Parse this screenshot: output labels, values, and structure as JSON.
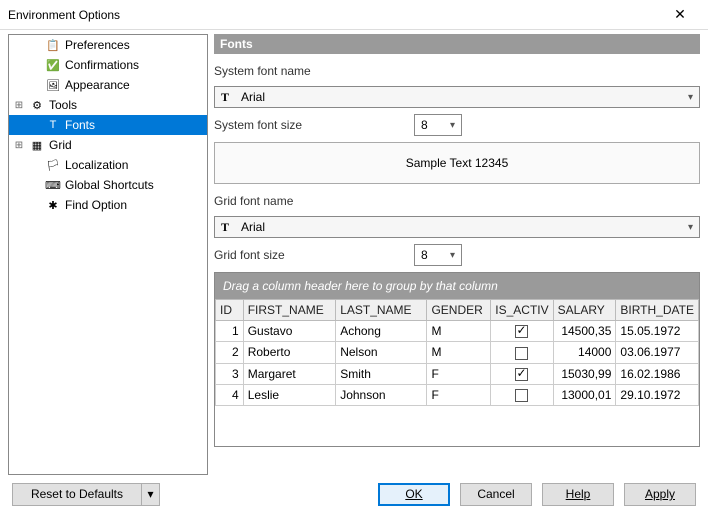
{
  "window": {
    "title": "Environment Options"
  },
  "tree": {
    "items": [
      {
        "label": "Preferences",
        "depth": 1
      },
      {
        "label": "Confirmations",
        "depth": 1
      },
      {
        "label": "Appearance",
        "depth": 1
      },
      {
        "label": "Tools",
        "depth": 0,
        "expander": "+"
      },
      {
        "label": "Fonts",
        "depth": 1,
        "selected": true
      },
      {
        "label": "Grid",
        "depth": 0,
        "expander": "+"
      },
      {
        "label": "Localization",
        "depth": 1
      },
      {
        "label": "Global Shortcuts",
        "depth": 1
      },
      {
        "label": "Find Option",
        "depth": 1
      }
    ]
  },
  "panel": {
    "title": "Fonts",
    "system_font_label": "System font name",
    "system_font_value": "Arial",
    "system_size_label": "System font size",
    "system_size_value": "8",
    "sample_text": "Sample Text 12345",
    "grid_font_label": "Grid font name",
    "grid_font_value": "Arial",
    "grid_size_label": "Grid font size",
    "grid_size_value": "8",
    "group_hint": "Drag a column header here to group by that column",
    "columns": [
      "ID",
      "FIRST_NAME",
      "LAST_NAME",
      "GENDER",
      "IS_ACTIV",
      "SALARY",
      "BIRTH_DATE"
    ],
    "rows": [
      {
        "id": "1",
        "fn": "Gustavo",
        "ln": "Achong",
        "g": "M",
        "active": true,
        "salary": "14500,35",
        "birth": "15.05.1972"
      },
      {
        "id": "2",
        "fn": "Roberto",
        "ln": "Nelson",
        "g": "M",
        "active": false,
        "salary": "14000",
        "birth": "03.06.1977"
      },
      {
        "id": "3",
        "fn": "Margaret",
        "ln": "Smith",
        "g": "F",
        "active": true,
        "salary": "15030,99",
        "birth": "16.02.1986"
      },
      {
        "id": "4",
        "fn": "Leslie",
        "ln": "Johnson",
        "g": "F",
        "active": false,
        "salary": "13000,01",
        "birth": "29.10.1972"
      }
    ]
  },
  "footer": {
    "reset": "Reset to Defaults",
    "ok": "OK",
    "cancel": "Cancel",
    "help": "Help",
    "apply": "Apply"
  }
}
